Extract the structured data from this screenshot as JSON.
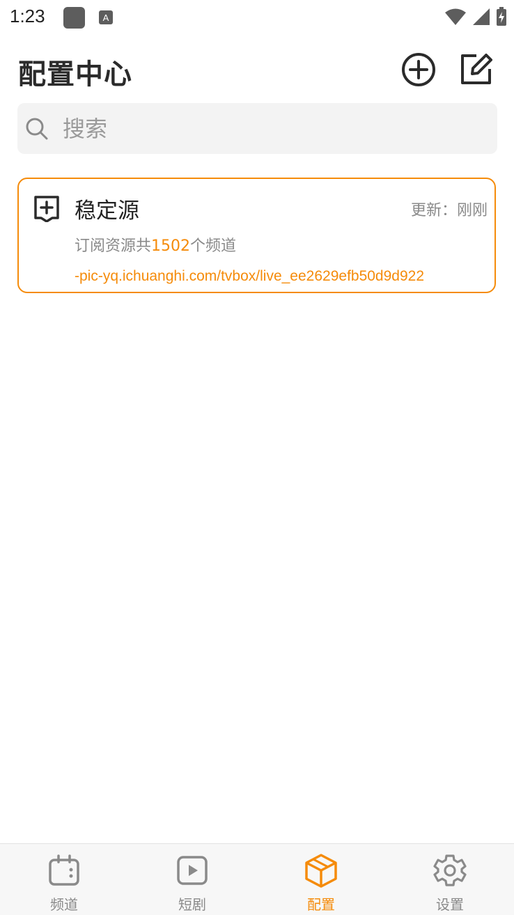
{
  "status_bar": {
    "time": "1:23"
  },
  "header": {
    "title": "配置中心"
  },
  "search": {
    "placeholder": "搜索"
  },
  "config_list": [
    {
      "title": "稳定源",
      "updated_label": "更新：刚刚",
      "desc_prefix": "订阅资源共",
      "channel_count": "1502",
      "desc_suffix": "个频道",
      "url": "-pic-yq.ichuanghi.com/tvbox/live_ee2629efb50d9d922"
    }
  ],
  "bottom_nav": {
    "items": [
      {
        "label": "频道",
        "icon": "calendar-icon",
        "active": false
      },
      {
        "label": "短剧",
        "icon": "play-icon",
        "active": false
      },
      {
        "label": "配置",
        "icon": "box-icon",
        "active": true
      },
      {
        "label": "设置",
        "icon": "gear-icon",
        "active": false
      }
    ]
  },
  "colors": {
    "accent": "#f58b0a",
    "text": "#222222",
    "muted": "#8a8a8a",
    "search_bg": "#f3f3f3"
  }
}
